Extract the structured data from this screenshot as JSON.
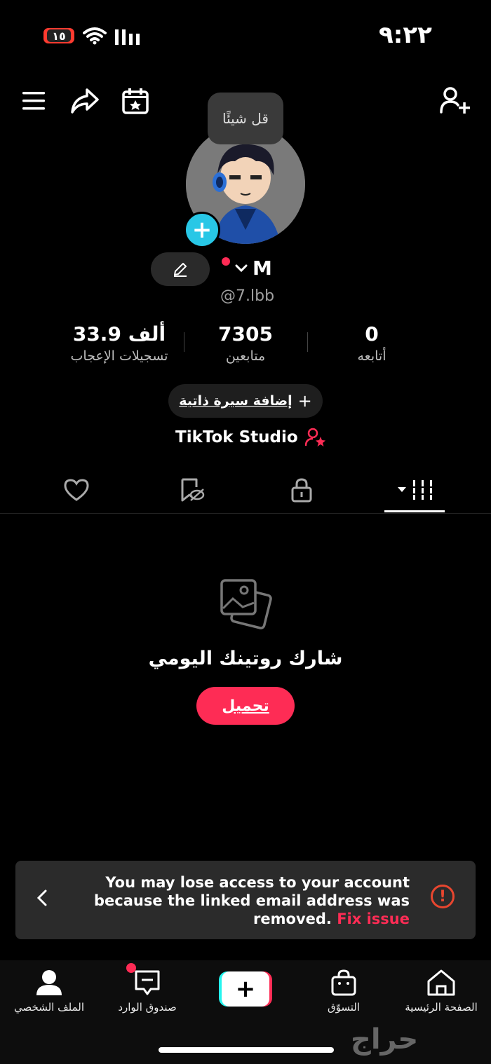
{
  "status_bar": {
    "time": "٩:٢٢",
    "battery": "١٥"
  },
  "tooltip": {
    "text": "قل شيئًا"
  },
  "profile": {
    "name": "M",
    "handle": "@7.lbb",
    "stats": [
      {
        "value": "33.9 ألف",
        "label": "تسجيلات الإعجاب"
      },
      {
        "value": "7305",
        "label": "متابعين"
      },
      {
        "value": "0",
        "label": "أتابعه"
      }
    ],
    "bio_button": "إضافة سيرة ذاتية",
    "studio_label": "TikTok Studio"
  },
  "empty_state": {
    "text": "شارك روتينك اليومي",
    "button": "تحميل"
  },
  "banner": {
    "message": "You may lose access to your account because the linked email address was removed.",
    "fix_label": "Fix issue"
  },
  "bottom_nav": {
    "profile": "الملف الشخصي",
    "inbox": "صندوق الوارد",
    "shop": "التسوّق",
    "home": "الصفحة الرئيسية"
  },
  "watermark": "حراج",
  "colors": {
    "accent": "#fe2c55",
    "cyan": "#25f4ee",
    "warning": "#e8462f"
  }
}
